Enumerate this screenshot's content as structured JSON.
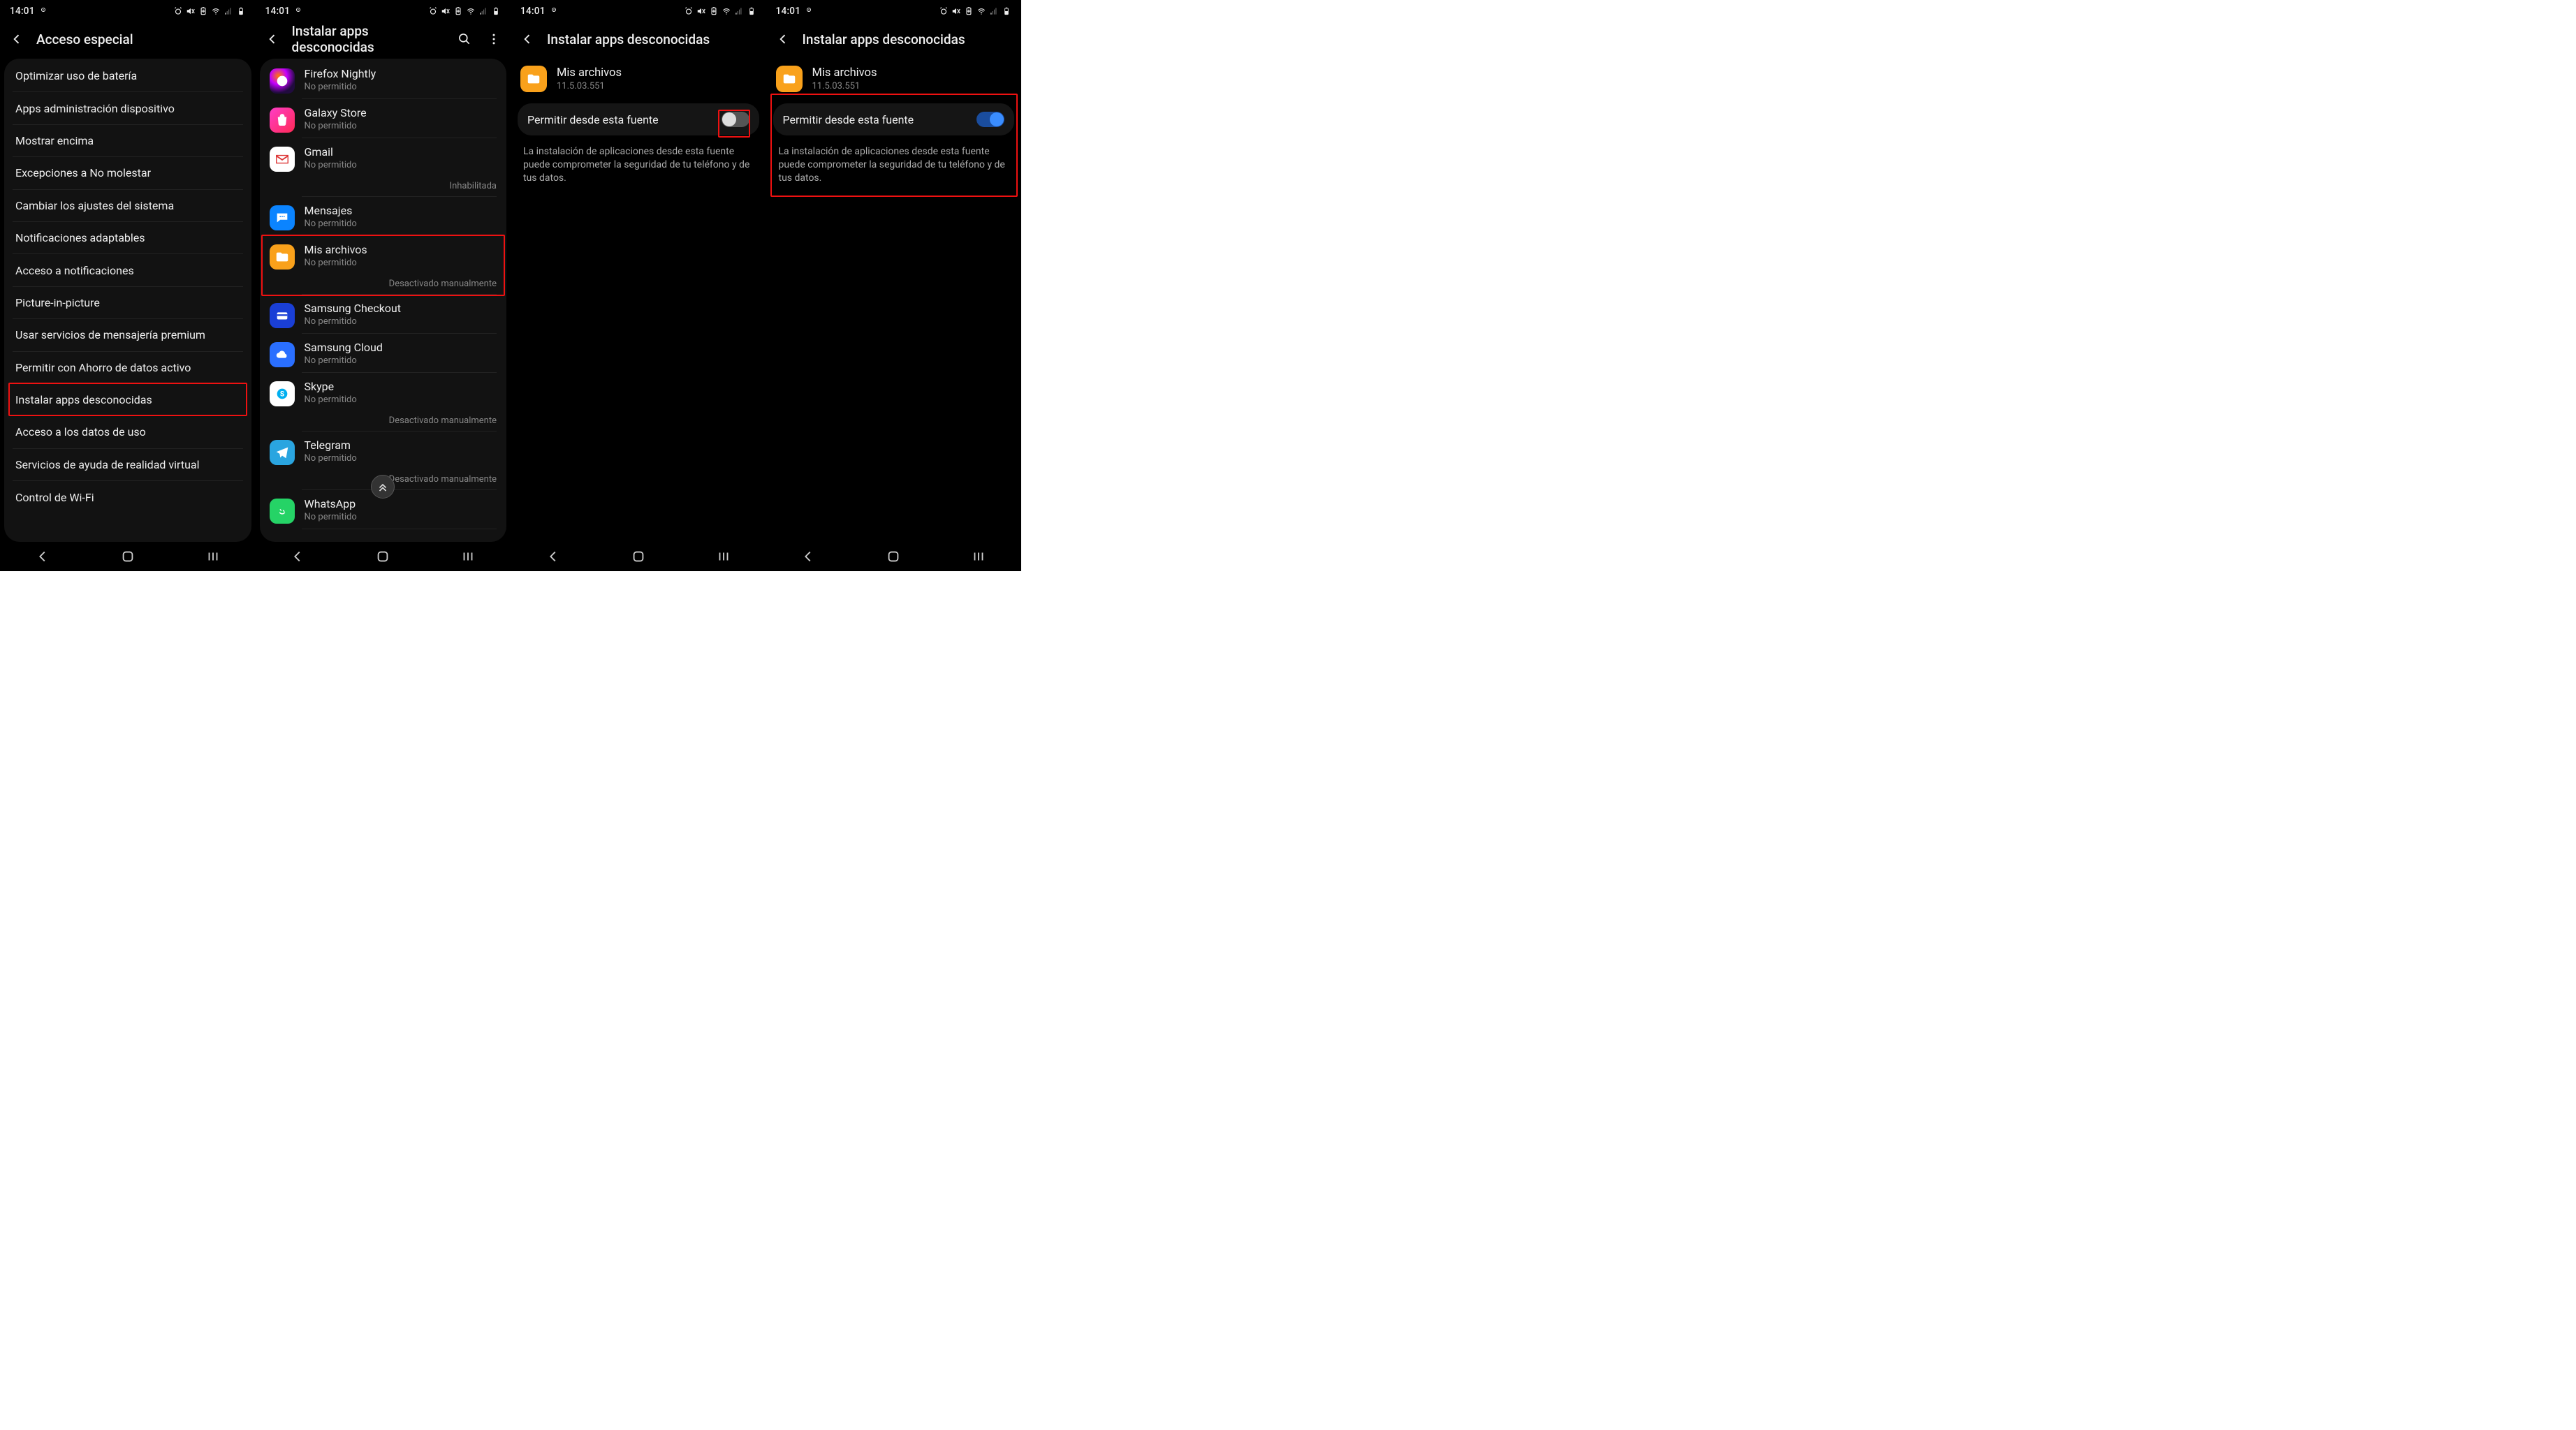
{
  "status": {
    "time": "14:01"
  },
  "nav": {
    "back_sr": "Atrás",
    "recents_sr": "Recientes",
    "home_sr": "Inicio",
    "overview_sr": "Atrás"
  },
  "panel1": {
    "title": "Acceso especial",
    "items": [
      "Optimizar uso de batería",
      "Apps administración dispositivo",
      "Mostrar encima",
      "Excepciones a No molestar",
      "Cambiar los ajustes del sistema",
      "Notificaciones adaptables",
      "Acceso a notificaciones",
      "Picture-in-picture",
      "Usar servicios de mensajería premium",
      "Permitir con Ahorro de datos activo",
      "Instalar apps desconocidas",
      "Acceso a los datos de uso",
      "Servicios de ayuda de realidad virtual",
      "Control de Wi-Fi"
    ],
    "highlight_index": 10
  },
  "panel2": {
    "title": "Instalar apps desconocidas",
    "not_allowed": "No permitido",
    "disabled": "Inhabilitada",
    "manually_disabled": "Desactivado manualmente",
    "apps": [
      {
        "name": "Firefox Nightly",
        "sub": "No permitido",
        "icon": "firefox",
        "extra": null
      },
      {
        "name": "Galaxy Store",
        "sub": "No permitido",
        "icon": "galaxy",
        "extra": null
      },
      {
        "name": "Gmail",
        "sub": "No permitido",
        "icon": "gmail",
        "extra": "Inhabilitada"
      },
      {
        "name": "Mensajes",
        "sub": "No permitido",
        "icon": "messages",
        "extra": null
      },
      {
        "name": "Mis archivos",
        "sub": "No permitido",
        "icon": "files",
        "extra": "Desactivado manualmente"
      },
      {
        "name": "Samsung Checkout",
        "sub": "No permitido",
        "icon": "checkout",
        "extra": null
      },
      {
        "name": "Samsung Cloud",
        "sub": "No permitido",
        "icon": "cloud",
        "extra": null
      },
      {
        "name": "Skype",
        "sub": "No permitido",
        "icon": "skype",
        "extra": "Desactivado manualmente"
      },
      {
        "name": "Telegram",
        "sub": "No permitido",
        "icon": "telegram",
        "extra": "Desactivado manualmente"
      },
      {
        "name": "WhatsApp",
        "sub": "No permitido",
        "icon": "whatsapp",
        "extra": null
      }
    ],
    "highlight_index": 4
  },
  "detail": {
    "title": "Instalar apps desconocidas",
    "app_name": "Mis archivos",
    "app_version": "11.5.03.551",
    "toggle_label": "Permitir desde esta fuente",
    "warning": "La instalación de aplicaciones desde esta fuente puede comprometer la seguridad de tu teléfono y de tus datos."
  }
}
